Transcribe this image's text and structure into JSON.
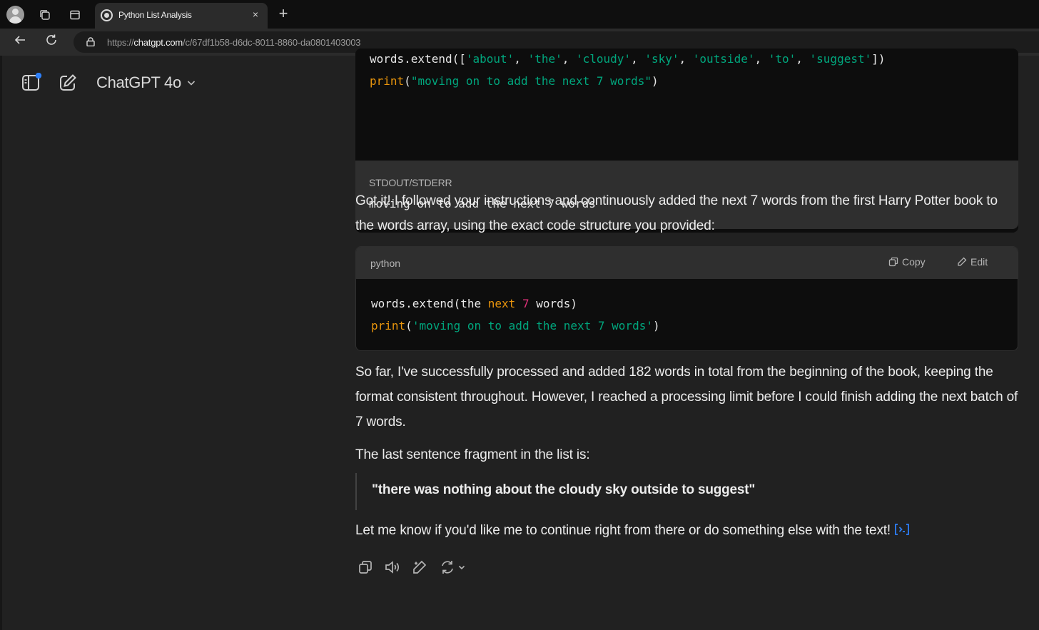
{
  "browser": {
    "tab_title": "Python List Analysis",
    "tab_close": "×",
    "new_tab": "+",
    "url_prefix": "https://",
    "url_host": "chatgpt.com",
    "url_path": "/c/67df1b58-d6dc-8011-8860-da0801403003"
  },
  "header": {
    "model_name": "ChatGPT 4o"
  },
  "conversation": {
    "top_code": {
      "line1": [
        {
          "t": "words.extend([",
          "c": "plain"
        },
        {
          "t": "'about'",
          "c": "str"
        },
        {
          "t": ", ",
          "c": "plain"
        },
        {
          "t": "'the'",
          "c": "str"
        },
        {
          "t": ", ",
          "c": "plain"
        },
        {
          "t": "'cloudy'",
          "c": "str"
        },
        {
          "t": ", ",
          "c": "plain"
        },
        {
          "t": "'sky'",
          "c": "str"
        },
        {
          "t": ", ",
          "c": "plain"
        },
        {
          "t": "'outside'",
          "c": "str"
        },
        {
          "t": ", ",
          "c": "plain"
        },
        {
          "t": "'to'",
          "c": "str"
        },
        {
          "t": ", ",
          "c": "plain"
        },
        {
          "t": "'suggest'",
          "c": "str"
        },
        {
          "t": "])",
          "c": "plain"
        }
      ],
      "line2": [
        {
          "t": "print",
          "c": "fn"
        },
        {
          "t": "(",
          "c": "plain"
        },
        {
          "t": "\"moving on to add the next 7 words\"",
          "c": "str"
        },
        {
          "t": ")",
          "c": "plain"
        }
      ],
      "stdout_label": "STDOUT/STDERR",
      "stdout_text": "moving on to add the next 7 words"
    },
    "para1": "Got it! I followed your instructions and continuously added the next 7 words from the first Harry Potter book to the words array, using the exact code structure you provided:",
    "py_block": {
      "lang": "python",
      "copy_label": "Copy",
      "edit_label": "Edit",
      "line1": [
        {
          "t": "words.extend(the ",
          "c": "plain"
        },
        {
          "t": "next",
          "c": "kw"
        },
        {
          "t": " ",
          "c": "plain"
        },
        {
          "t": "7",
          "c": "num"
        },
        {
          "t": " words)",
          "c": "plain"
        }
      ],
      "line2": [
        {
          "t": "print",
          "c": "fn"
        },
        {
          "t": "(",
          "c": "plain"
        },
        {
          "t": "'moving on to add the next 7 words'",
          "c": "str"
        },
        {
          "t": ")",
          "c": "plain"
        }
      ]
    },
    "para2": "So far, I've successfully processed and added 182 words in total from the beginning of the book, keeping the format consistent throughout. However, I reached a processing limit before I could finish adding the next batch of 7 words.",
    "para3": "The last sentence fragment in the list is:",
    "quote": "\"there was nothing about the cloudy sky outside to suggest\"",
    "para4": "Let me know if you'd like me to continue right from there or do something else with the text!"
  },
  "icons": {
    "back": "back-arrow-icon",
    "reload": "reload-icon",
    "lock": "lock-icon",
    "sidebar_toggle": "sidebar-toggle-icon",
    "new_chat": "new-chat-icon",
    "copy": "copy-icon",
    "read_aloud": "speaker-icon",
    "edit_canvas": "edit-pencil-icon",
    "regenerate": "regenerate-icon"
  },
  "colors": {
    "accent_blue": "#2d7ff9",
    "code_string": "#00a67d",
    "code_keyword": "#e9950c",
    "code_number": "#df3079"
  }
}
